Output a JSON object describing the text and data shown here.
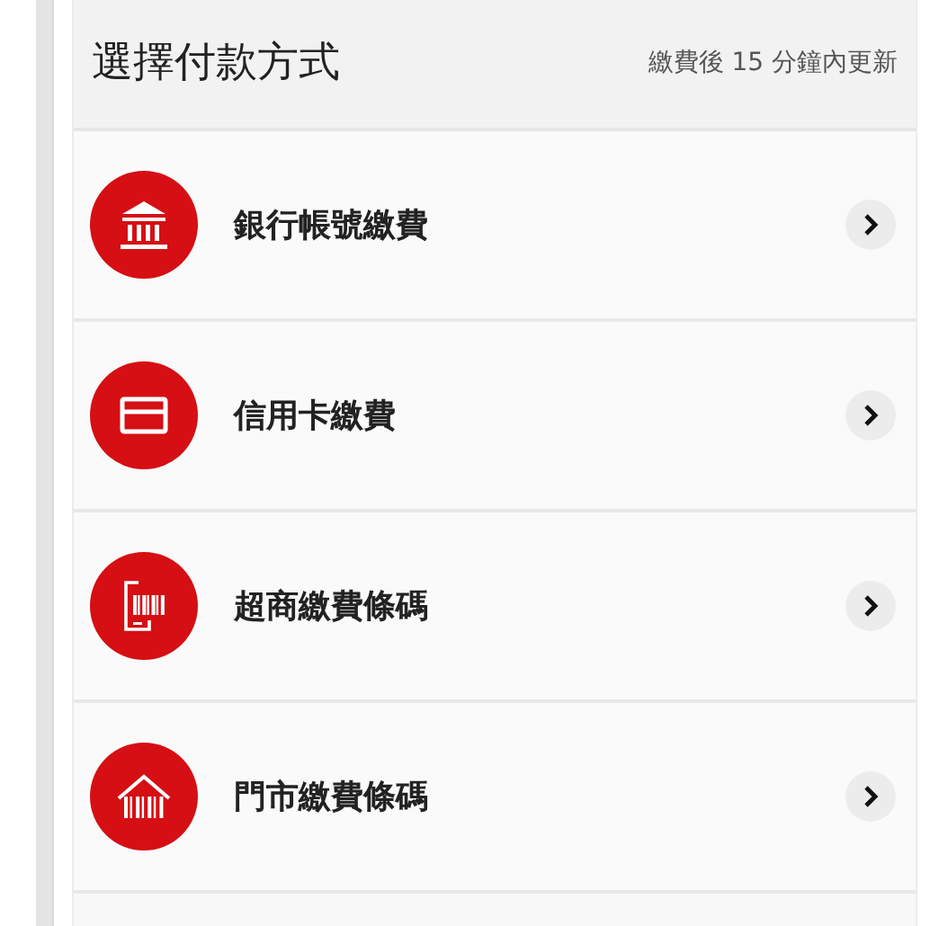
{
  "header": {
    "title": "選擇付款方式",
    "note": "繳費後 15 分鐘內更新"
  },
  "methods": [
    {
      "kind": "bank",
      "label": "銀行帳號繳費"
    },
    {
      "kind": "card",
      "label": "信用卡繳費"
    },
    {
      "kind": "phone-barcode",
      "label": "超商繳費條碼"
    },
    {
      "kind": "store-barcode",
      "label": "門市繳費條碼"
    }
  ]
}
